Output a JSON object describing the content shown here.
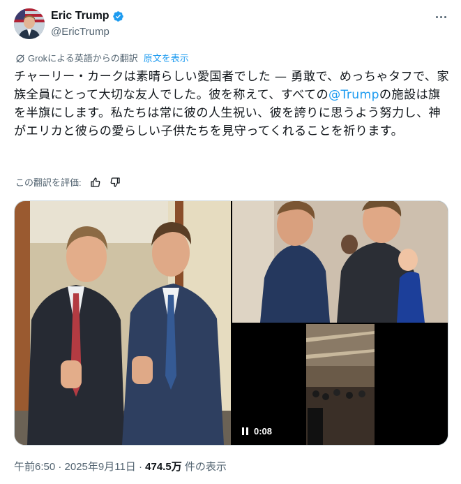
{
  "author": {
    "display_name": "Eric Trump",
    "handle": "@EricTrump"
  },
  "translation": {
    "label": "Grokによる英語からの翻訳",
    "show_original": "原文を表示"
  },
  "tweet": {
    "text_before": "チャーリー・カークは素晴らしい愛国者でした — 勇敢で、めっちゃタフで、家族全員にとって大切な友人でした。彼を称えて、すべての",
    "mention": "@Trump",
    "text_after": "の施設は旗を半旗にします。私たちは常に彼の人生祝い、彼を誇りに思うよう努力し、神がエリカと彼らの愛らしい子供たちを見守ってくれることを祈ります。"
  },
  "rating": {
    "label": "この翻訳を評価:"
  },
  "media": {
    "video_time": "0:08"
  },
  "meta": {
    "timestamp": "午前6:50 · 2025年9月11日",
    "separator": " · ",
    "views_count": "474.5万",
    "views_label": " 件の表示"
  },
  "colors": {
    "accent": "#1d9bf0",
    "secondary_text": "#536471",
    "primary_text": "#0f1419"
  },
  "icons": [
    "verified-badge-icon",
    "more-options-icon",
    "grok-icon",
    "thumbs-up-icon",
    "thumbs-down-icon",
    "pause-icon"
  ]
}
